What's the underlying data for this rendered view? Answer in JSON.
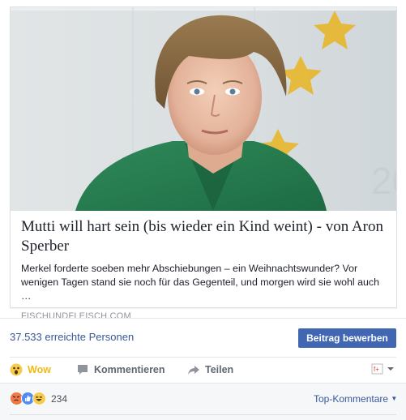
{
  "post": {
    "image_alt": "Porträtfoto einer Frau mit grüner Jacke vor Sternen-Hintergrund",
    "headline": "Mutti will hart sein (bis wieder ein Kind weint) - von Aron Sperber",
    "summary": "Merkel forderte soeben mehr Abschiebungen – ein Weihnachtswunder? Vor wenigen Tagen stand sie noch für das Gegenteil, und morgen wird sie wohl auch …",
    "domain": "FISCHUNDFLEISCH.COM"
  },
  "reach": {
    "text": "37.533 erreichte Personen",
    "boost_label": "Beitrag bewerben"
  },
  "actions": {
    "wow_label": "Wow",
    "comment_label": "Kommentieren",
    "share_label": "Teilen"
  },
  "reactions": {
    "icons": [
      "angry-icon",
      "like-icon",
      "haha-icon"
    ],
    "count": "234"
  },
  "comments": {
    "sort_label": "Top-Kommentare"
  },
  "colors": {
    "link": "#365899",
    "button": "#4267b2",
    "wow": "#f0ba15"
  }
}
